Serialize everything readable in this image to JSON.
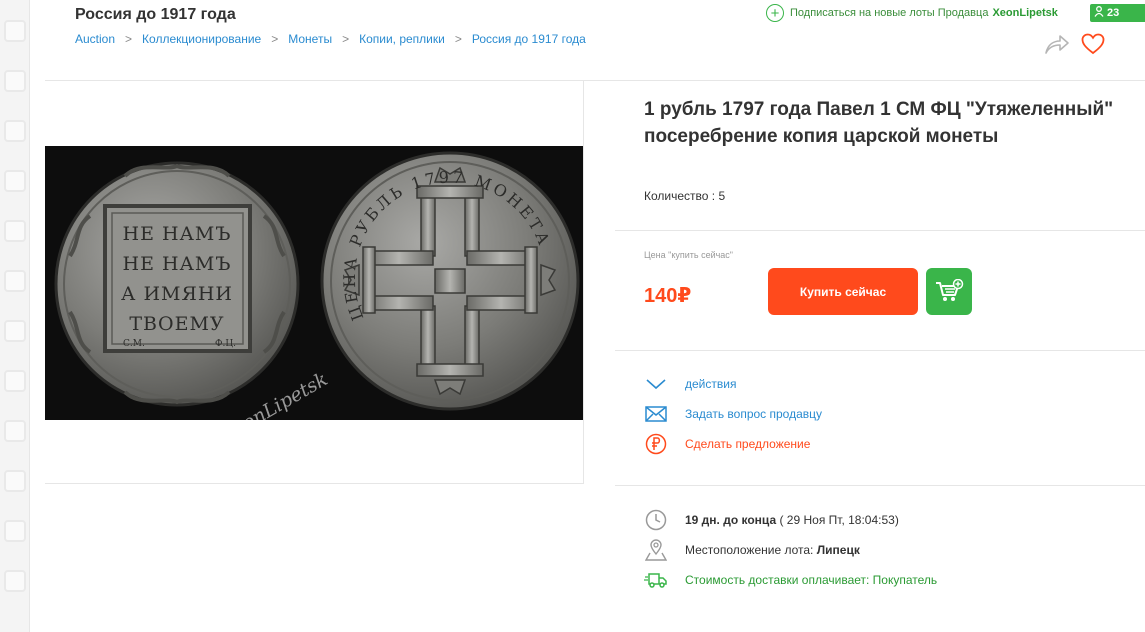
{
  "header": {
    "title": "Россия до 1917 года",
    "breadcrumb": [
      "Auction",
      "Коллекционирование",
      "Монеты",
      "Копии, реплики",
      "Россия до 1917 года"
    ],
    "breadcrumb_separator": ">",
    "subscribe_label": "Подписаться на новые лоты Продавца",
    "seller_name": "XeonLipetsk",
    "seller_rating": "23"
  },
  "lot": {
    "title": "1 рубль 1797 года Павел 1 СМ ФЦ \"Утяжеленный\" посеребрение копия царской монеты",
    "quantity_label": "Количество",
    "quantity_value": "5",
    "price_label": "Цена \"купить сейчас\"",
    "price": "140₽",
    "buy_now_label": "Купить сейчас"
  },
  "image": {
    "obverse_text": [
      "НЕ НАМЪ",
      "НЕ НАМЪ",
      "А ИМЯНИ",
      "ТВОЕМУ"
    ],
    "obverse_marks": [
      "С.М.",
      "Ф.Ц."
    ],
    "reverse_legend": "ЦЕНА РУБЛЬ 1797 МОНЕТА",
    "watermark": "XeonLipetsk"
  },
  "actions": [
    {
      "label": "действия",
      "icon": "chevron-down-icon"
    },
    {
      "label": "Задать вопрос продавцу",
      "icon": "mail-icon"
    },
    {
      "label": "Сделать предложение",
      "icon": "ruble-icon"
    }
  ],
  "info": {
    "time_left": "19 дн. до конца",
    "end_date": "( 29 Ноя Пт, 18:04:53)",
    "location_label": "Местоположение лота:",
    "location_value": "Липецк",
    "shipping": "Стоимость доставки оплачивает: Покупатель"
  },
  "colors": {
    "accent_orange": "#ff4a1c",
    "accent_green": "#3ab54a",
    "link_blue": "#2a8bd0"
  }
}
